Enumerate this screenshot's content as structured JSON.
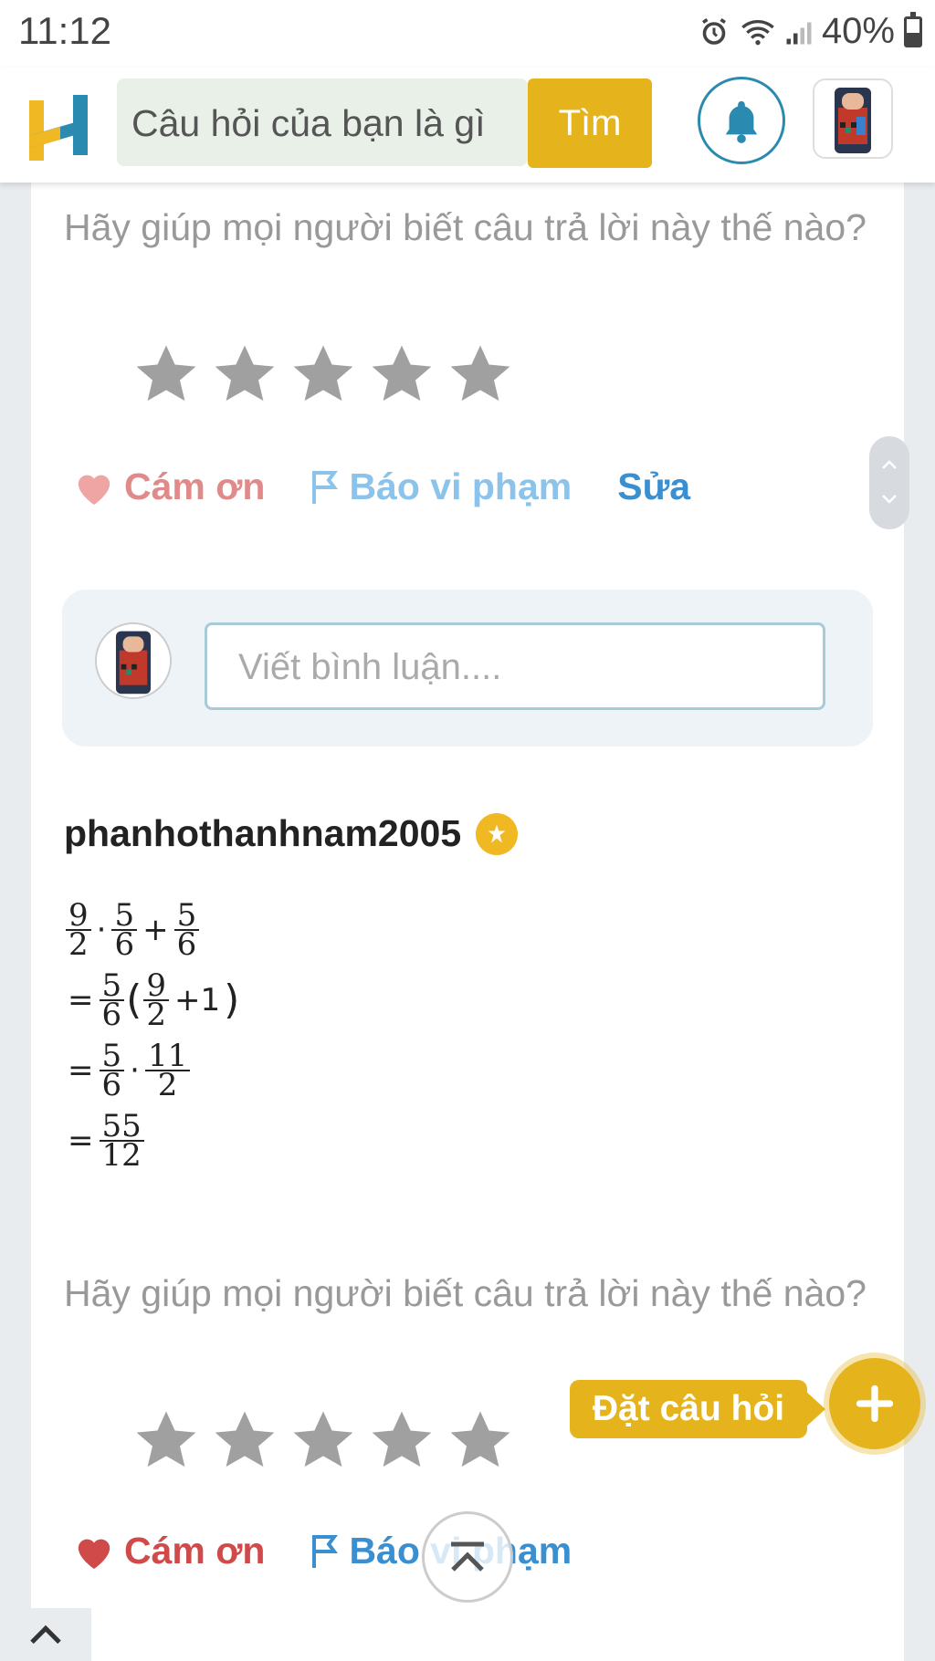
{
  "status": {
    "time": "11:12",
    "battery": "40%"
  },
  "header": {
    "search_placeholder": "Câu hỏi của bạn là gì",
    "search_button": "Tìm",
    "icons": [
      "hoc24-logo-icon",
      "bell-icon",
      "user-avatar"
    ]
  },
  "answer1": {
    "rating_prompt": "Hãy giúp mọi người biết câu trả lời này thế nào?",
    "stars_filled": 0,
    "stars_total": 5,
    "thanks_label": "Cám ơn",
    "report_label": "Báo vi phạm",
    "edit_label": "Sửa"
  },
  "comment": {
    "placeholder": "Viết bình luận...."
  },
  "answer2": {
    "username": "phanhothanhnam2005",
    "math_lines": [
      "9/2 · 5/6 + 5/6",
      "= 5/6 (9/2 + 1)",
      "= 5/6 · 11/2",
      "= 55/12"
    ],
    "rating_prompt": "Hãy giúp mọi người biết câu trả lời này thế nào?",
    "stars_filled": 0,
    "stars_total": 5,
    "thanks_label": "Cám ơn",
    "report_label": "Báo vi phạm"
  },
  "fab": {
    "ask_label": "Đặt câu hỏi"
  },
  "colors": {
    "accent": "#e5b41c",
    "link": "#3a8fd1",
    "heart": "#d14a4a",
    "star": "#a0a0a0"
  }
}
